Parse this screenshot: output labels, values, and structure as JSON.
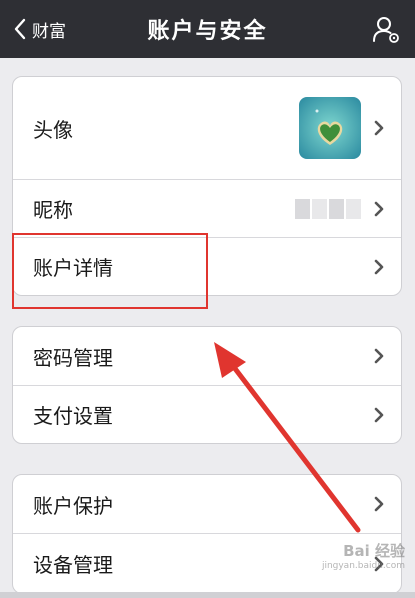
{
  "navbar": {
    "back_label": "财富",
    "title": "账户与安全",
    "right_icon": "user-settings-icon"
  },
  "groups": [
    {
      "items": [
        {
          "label": "头像",
          "trailing": "avatar"
        },
        {
          "label": "昵称",
          "trailing": "masked-nickname"
        },
        {
          "label": "账户详情",
          "trailing": "none"
        }
      ]
    },
    {
      "items": [
        {
          "label": "密码管理"
        },
        {
          "label": "支付设置"
        }
      ]
    },
    {
      "items": [
        {
          "label": "账户保护"
        },
        {
          "label": "设备管理"
        }
      ]
    }
  ],
  "annotation": {
    "highlight_color": "#e0352f",
    "arrow_color": "#e0352f"
  },
  "watermark": {
    "logo": "Bai 经验",
    "url": "jingyan.baidu.com"
  },
  "colors": {
    "navbar": "#2e2f34",
    "background": "#ececef",
    "row_bg": "#ffffff",
    "chevron": "#555555"
  }
}
